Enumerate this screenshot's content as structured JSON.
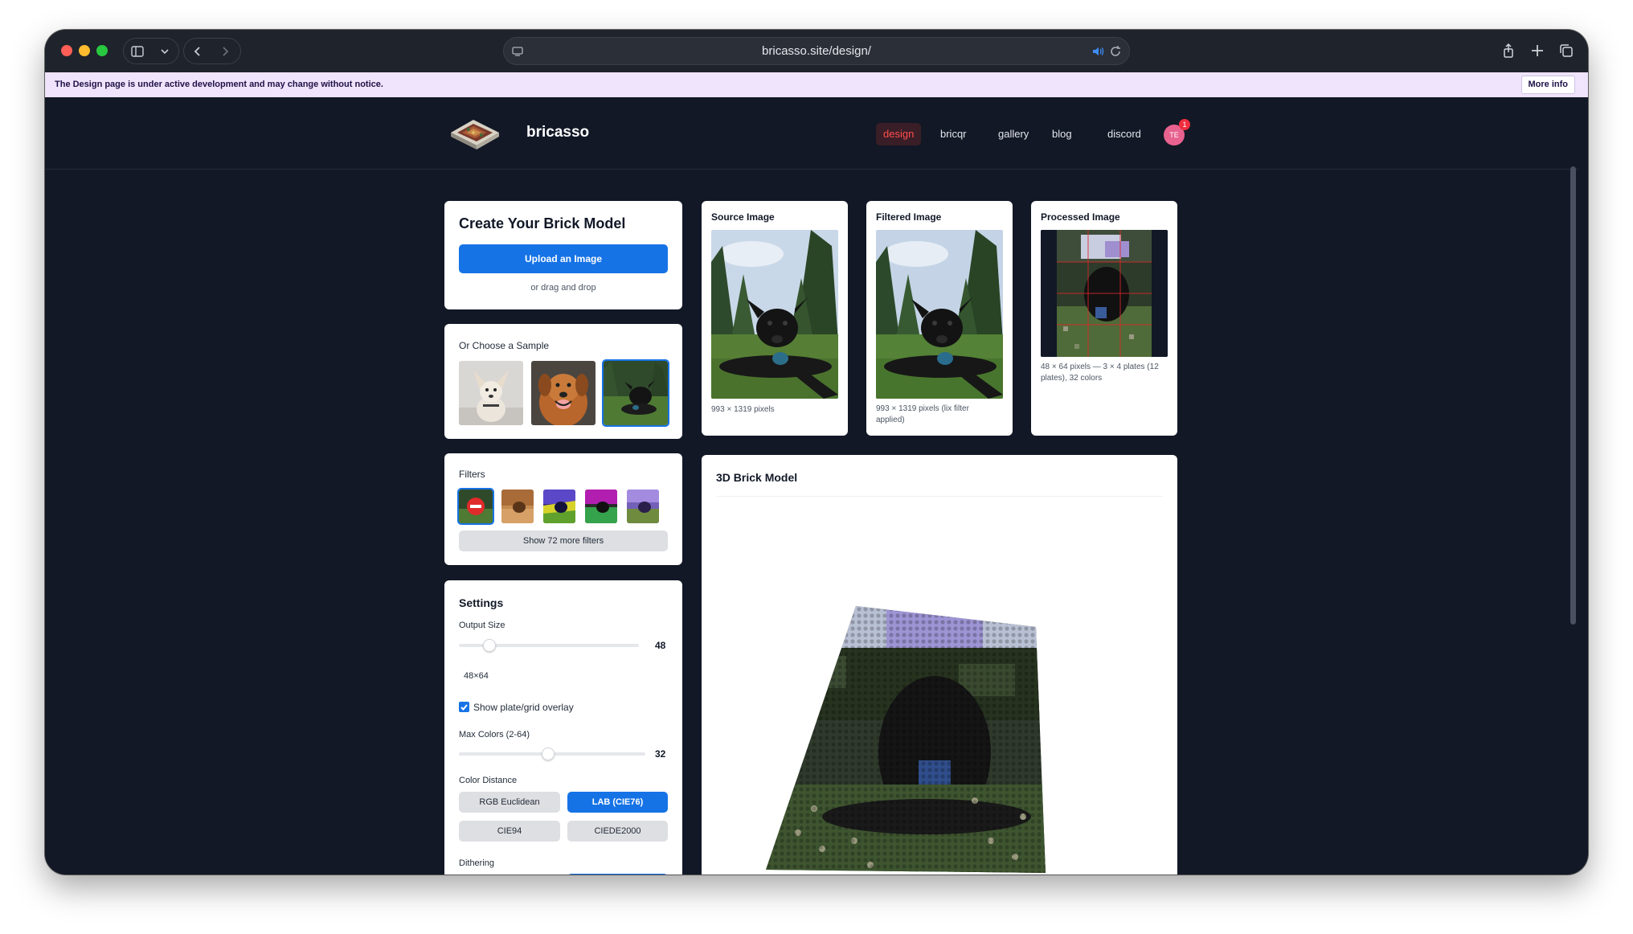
{
  "browser": {
    "url": "bricasso.site/design/"
  },
  "notice": {
    "text": "The Design page is under active development and may change without notice.",
    "button": "More info"
  },
  "nav": {
    "brand": "bricasso",
    "links": [
      "design",
      "bricqr",
      "gallery",
      "blog",
      "discord"
    ],
    "active": "design",
    "avatar_initials": "TE",
    "avatar_badge": "1"
  },
  "create": {
    "title": "Create Your Brick Model",
    "upload_label": "Upload an Image",
    "drag_text": "or drag and drop"
  },
  "samples": {
    "title": "Or Choose a Sample"
  },
  "filters": {
    "title": "Filters",
    "more_label": "Show 72 more filters"
  },
  "settings": {
    "title": "Settings",
    "output_size_label": "Output Size",
    "output_size_value": "48",
    "output_size_fraction": 0.17,
    "dimensions": "48×64",
    "overlay_label": "Show plate/grid overlay",
    "overlay_checked": true,
    "max_colors_label": "Max Colors (2-64)",
    "max_colors_value": "32",
    "max_colors_fraction": 0.48,
    "color_distance_label": "Color Distance",
    "color_distance_options": [
      "RGB Euclidean",
      "LAB (CIE76)",
      "CIE94",
      "CIEDE2000"
    ],
    "color_distance_selected": "LAB (CIE76)",
    "dithering_label": "Dithering"
  },
  "source": {
    "title": "Source Image",
    "caption": "993 × 1319 pixels"
  },
  "filtered": {
    "title": "Filtered Image",
    "caption": "993 × 1319 pixels (lix filter applied)"
  },
  "processed": {
    "title": "Processed Image",
    "caption": "48 × 64 pixels — 3 × 4 plates (12 plates), 32 colors"
  },
  "model": {
    "title": "3D Brick Model"
  },
  "colors": {
    "accent_blue": "#1673e6",
    "nav_active_red": "#ff4d4d",
    "banner_bg": "#efe4fb",
    "page_bg": "#121826"
  }
}
